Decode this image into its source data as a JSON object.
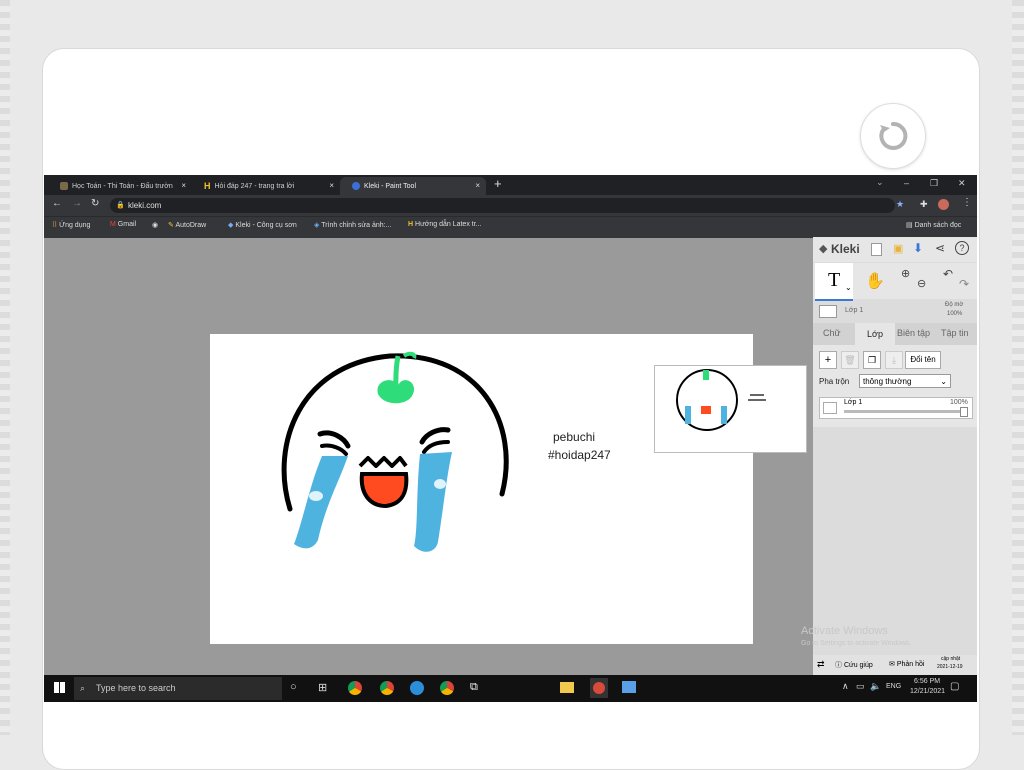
{
  "browser": {
    "tabs": [
      {
        "label": "Học Toán - Thi Toán - Đấu trườn"
      },
      {
        "label": "Hỏi đáp 247 - trang tra lời"
      },
      {
        "label": "Kleki - Paint Tool"
      }
    ],
    "new_tab": "+",
    "window_controls": {
      "dropdown": "⌄",
      "minimize": "–",
      "maximize": "❐",
      "close": "✕"
    },
    "address": "kleki.com",
    "bookmarks": [
      {
        "label": "Ứng dụng"
      },
      {
        "label": "Gmail"
      },
      {
        "label": "AutoDraw"
      },
      {
        "label": "Kleki - Công cụ sơn"
      },
      {
        "label": "Trình chỉnh sửa ảnh:..."
      },
      {
        "label": "Hướng dẫn Latex tr..."
      }
    ],
    "reading_list": "Danh sách đọc"
  },
  "canvas": {
    "name_text": "pebuchi",
    "tag_text": "#hoidap247"
  },
  "kleki": {
    "brand": "Kleki",
    "text_tool": "T",
    "layer_thumb_label": "Lớp 1",
    "opacity_title": "Độ mờ",
    "opacity_value": "100%",
    "tabs": [
      {
        "label": "Chữ"
      },
      {
        "label": "Lớp"
      },
      {
        "label": "Biên tập"
      },
      {
        "label": "Tập tin"
      }
    ],
    "rename_button": "Đổi tên",
    "blend_label": "Pha trộn",
    "blend_value": "thông thường",
    "layer_name": "Lớp 1",
    "layer_opacity": "100%",
    "help": "Cứu giúp",
    "feedback": "Phản hồi",
    "update_label": "cập nhật",
    "update_date": "2021-12-19",
    "activate_title": "Activate Windows",
    "activate_sub": "Go to Settings to activate Windows."
  },
  "taskbar": {
    "search_placeholder": "Type here to search",
    "lang": "ENG",
    "time": "6:56 PM",
    "date": "12/21/2021"
  },
  "colors": {
    "cry_blue": "#4fb3e0",
    "mouth_red": "#ff4b1f",
    "sprout_green": "#2edc7a"
  }
}
